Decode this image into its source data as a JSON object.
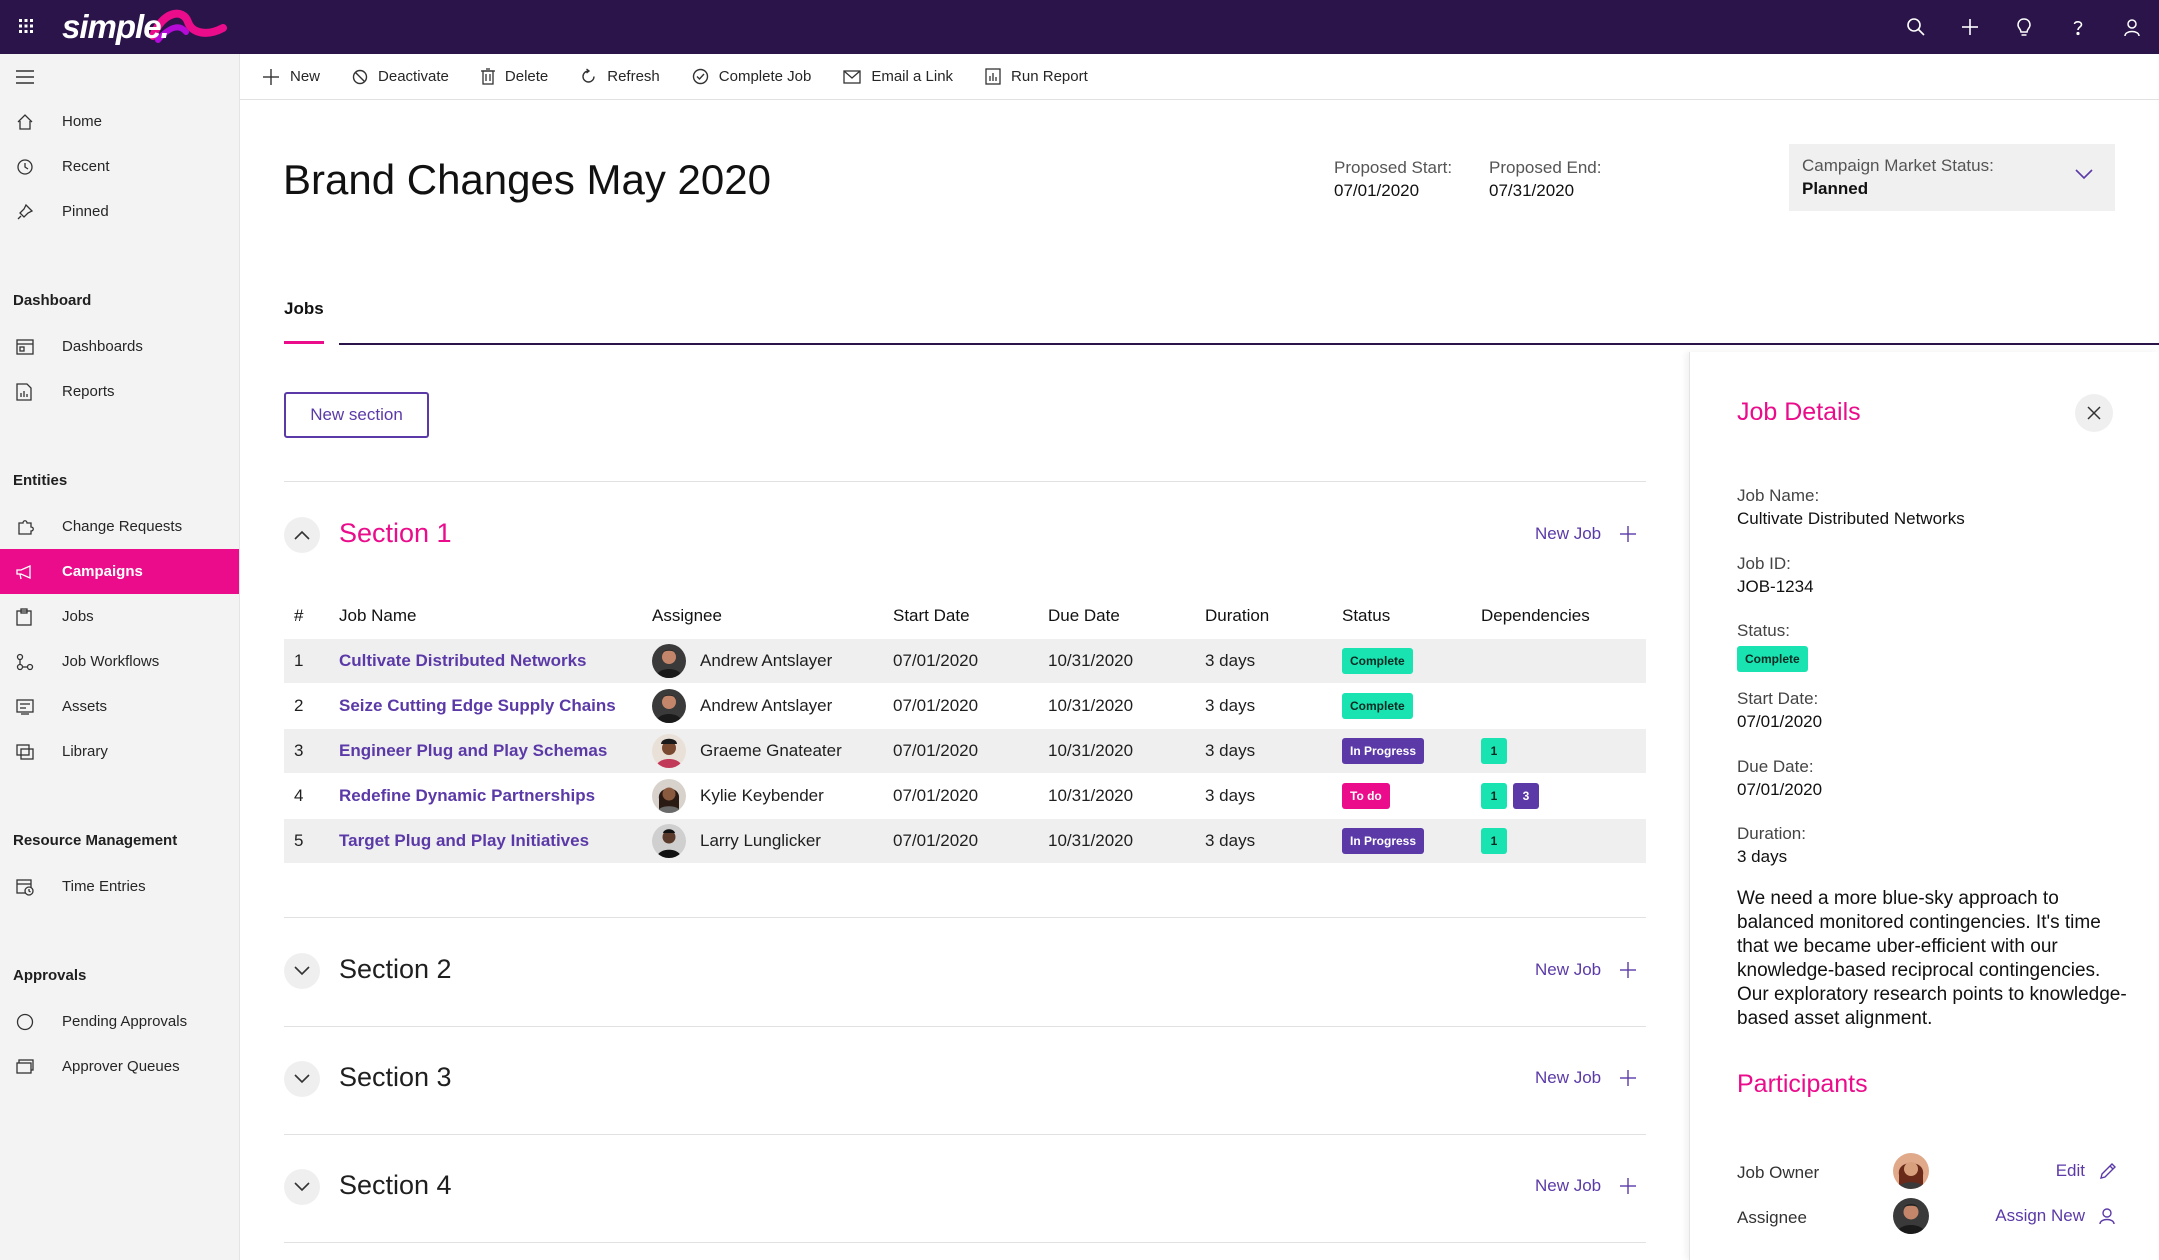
{
  "brand": {
    "logo_text": "simple."
  },
  "colors": {
    "accent": "#ea0c8b",
    "purple": "#5b3aa8",
    "topbar": "#2a1449",
    "teal": "#19e3b1"
  },
  "sidebar": {
    "top": [
      "Home",
      "Recent",
      "Pinned"
    ],
    "dashboard_head": "Dashboard",
    "dashboard": [
      "Dashboards",
      "Reports"
    ],
    "entities_head": "Entities",
    "entities": [
      "Change Requests",
      "Campaigns",
      "Jobs",
      "Job Workflows",
      "Assets",
      "Library"
    ],
    "resource_head": "Resource Management",
    "resource": [
      "Time Entries"
    ],
    "approvals_head": "Approvals",
    "approvals": [
      "Pending Approvals",
      "Approver Queues"
    ]
  },
  "commands": [
    "New",
    "Deactivate",
    "Delete",
    "Refresh",
    "Complete Job",
    "Email a Link",
    "Run Report"
  ],
  "header": {
    "title": "Brand Changes May 2020",
    "proposed_start_label": "Proposed Start:",
    "proposed_start": "07/01/2020",
    "proposed_end_label": "Proposed End:",
    "proposed_end": "07/31/2020",
    "market_status_label": "Campaign Market Status:",
    "market_status": "Planned"
  },
  "tabs": {
    "jobs": "Jobs"
  },
  "new_section_label": "New section",
  "new_job_label": "New Job",
  "sections": [
    "Section 1",
    "Section 2",
    "Section 3",
    "Section 4"
  ],
  "table": {
    "headers": [
      "#",
      "Job Name",
      "Assignee",
      "Start Date",
      "Due Date",
      "Duration",
      "Status",
      "Dependencies"
    ],
    "rows": [
      {
        "num": "1",
        "name": "Cultivate Distributed Networks",
        "assignee": "Andrew Antslayer",
        "start": "07/01/2020",
        "due": "10/31/2020",
        "duration": "3 days",
        "status": "Complete",
        "deps": []
      },
      {
        "num": "2",
        "name": "Seize Cutting Edge Supply Chains",
        "assignee": "Andrew Antslayer",
        "start": "07/01/2020",
        "due": "10/31/2020",
        "duration": "3 days",
        "status": "Complete",
        "deps": []
      },
      {
        "num": "3",
        "name": "Engineer Plug and Play Schemas",
        "assignee": "Graeme Gnateater",
        "start": "07/01/2020",
        "due": "10/31/2020",
        "duration": "3 days",
        "status": "In Progress",
        "deps": [
          "1"
        ]
      },
      {
        "num": "4",
        "name": "Redefine Dynamic Partnerships",
        "assignee": "Kylie Keybender",
        "start": "07/01/2020",
        "due": "10/31/2020",
        "duration": "3 days",
        "status": "To do",
        "deps": [
          "1",
          "3"
        ]
      },
      {
        "num": "5",
        "name": "Target Plug and Play Initiatives",
        "assignee": "Larry Lunglicker",
        "start": "07/01/2020",
        "due": "10/31/2020",
        "duration": "3 days",
        "status": "In Progress",
        "deps": [
          "1"
        ]
      }
    ]
  },
  "panel": {
    "title": "Job Details",
    "job_name_label": "Job Name:",
    "job_name": "Cultivate Distributed Networks",
    "job_id_label": "Job ID:",
    "job_id": "JOB-1234",
    "status_label": "Status:",
    "status": "Complete",
    "start_label": "Start Date:",
    "start": "07/01/2020",
    "due_label": "Due Date:",
    "due": "07/01/2020",
    "duration_label": "Duration:",
    "duration": "3 days",
    "description": "We need a more blue-sky approach to balanced monitored contingencies. It's time that we became uber-efficient with our knowledge-based reciprocal contingencies. Our exploratory research points to knowledge-based asset alignment.",
    "participants_title": "Participants",
    "owner_label": "Job Owner",
    "owner_action": "Edit",
    "assignee_label": "Assignee",
    "assignee_action": "Assign New"
  }
}
